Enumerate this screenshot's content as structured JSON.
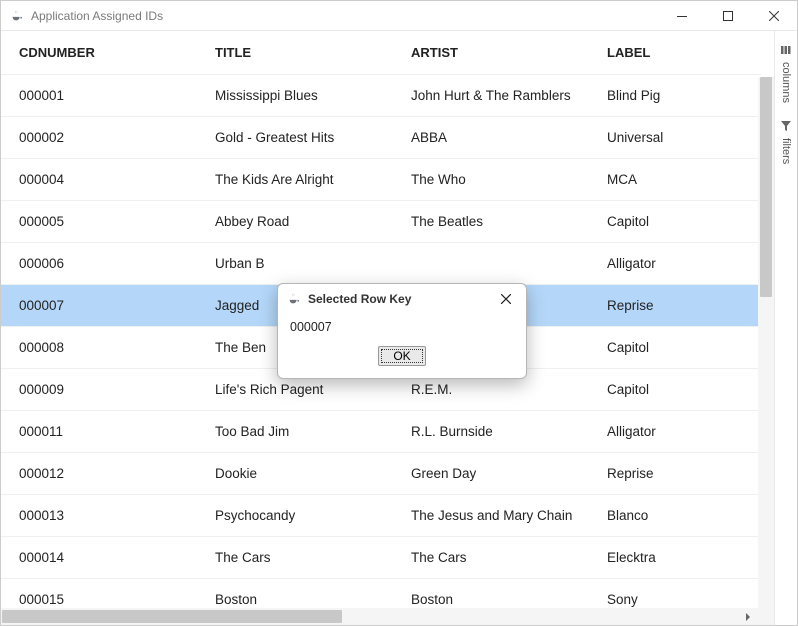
{
  "window": {
    "title": "Application Assigned IDs"
  },
  "side": {
    "columns_label": "columns",
    "filters_label": "filters"
  },
  "table": {
    "headers": {
      "cdnumber": "CDNUMBER",
      "title": "TITLE",
      "artist": "ARTIST",
      "label": "LABEL"
    },
    "rows": [
      {
        "cdnumber": "000001",
        "title": "Mississippi Blues",
        "artist": "John Hurt & The Ramblers",
        "label": "Blind Pig"
      },
      {
        "cdnumber": "000002",
        "title": "Gold - Greatest Hits",
        "artist": "ABBA",
        "label": "Universal"
      },
      {
        "cdnumber": "000004",
        "title": "The Kids Are Alright",
        "artist": "The Who",
        "label": "MCA"
      },
      {
        "cdnumber": "000005",
        "title": "Abbey Road",
        "artist": "The Beatles",
        "label": "Capitol"
      },
      {
        "cdnumber": "000006",
        "title": "Urban B",
        "artist": "",
        "label": "Alligator"
      },
      {
        "cdnumber": "000007",
        "title": "Jagged",
        "artist": "",
        "label": "Reprise"
      },
      {
        "cdnumber": "000008",
        "title": "The Ben",
        "artist": "",
        "label": "Capitol"
      },
      {
        "cdnumber": "000009",
        "title": "Life's Rich Pagent",
        "artist": "R.E.M.",
        "label": "Capitol"
      },
      {
        "cdnumber": "000011",
        "title": "Too Bad Jim",
        "artist": "R.L. Burnside",
        "label": "Alligator"
      },
      {
        "cdnumber": "000012",
        "title": "Dookie",
        "artist": "Green Day",
        "label": "Reprise"
      },
      {
        "cdnumber": "000013",
        "title": "Psychocandy",
        "artist": "The Jesus and Mary Chain",
        "label": "Blanco"
      },
      {
        "cdnumber": "000014",
        "title": "The Cars",
        "artist": "The Cars",
        "label": "Elecktra"
      },
      {
        "cdnumber": "000015",
        "title": "Boston",
        "artist": "Boston",
        "label": "Sony"
      }
    ],
    "selected_index": 5
  },
  "modal": {
    "title": "Selected Row Key",
    "value": "000007",
    "ok_label": "OK"
  }
}
